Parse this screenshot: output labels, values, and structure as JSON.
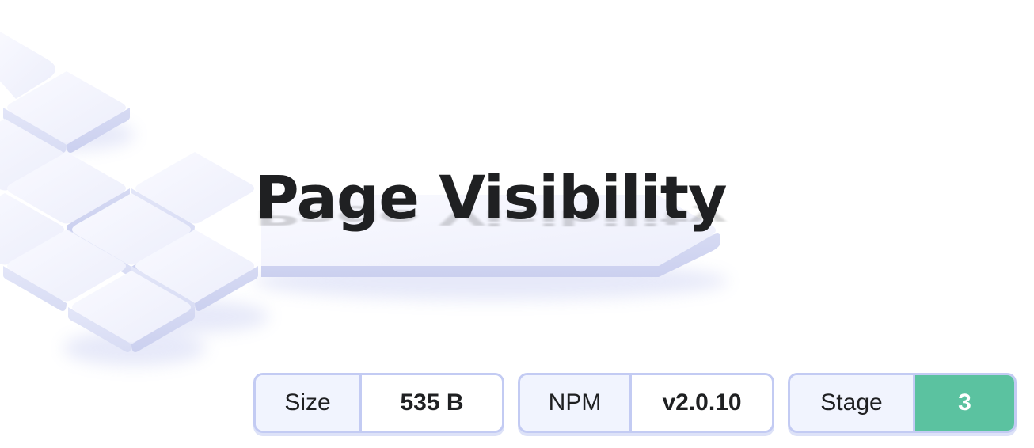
{
  "title": "Page Visibility",
  "badges": {
    "size": {
      "label": "Size",
      "value": "535 B"
    },
    "npm": {
      "label": "NPM",
      "value": "v2.0.10"
    },
    "stage": {
      "label": "Stage",
      "value": "3"
    }
  },
  "colors": {
    "title": "#1f2022",
    "badge_border": "#c3cbf3",
    "badge_label_bg": "#f1f4fe",
    "stage_value_bg": "#5bc2a0",
    "tile_top": "#f2f3fd",
    "tile_side": "#d6daf3"
  }
}
